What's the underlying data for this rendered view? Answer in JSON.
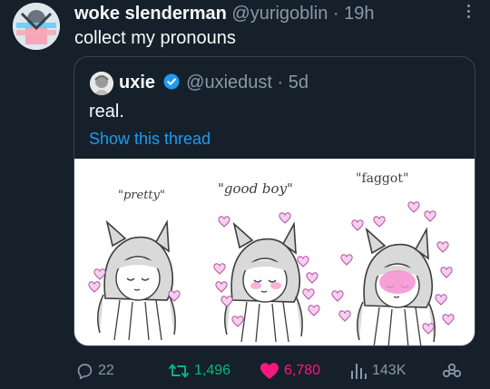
{
  "tweet": {
    "author_name": "woke slenderman",
    "author_handle": "@yurigoblin",
    "separator": "·",
    "time": "19h",
    "text": "collect my pronouns"
  },
  "quoted": {
    "author_name": "uxie",
    "author_handle": "@uxiedust",
    "separator": "·",
    "time": "5d",
    "text": "real.",
    "show_thread": "Show this thread",
    "image": {
      "captions": [
        "\"pretty\"",
        "\"good boy\"",
        "\"faggot\""
      ]
    }
  },
  "actions": {
    "replies": "22",
    "retweets": "1,496",
    "likes": "6,780",
    "views": "143K"
  },
  "icons": {
    "more": "more-options-icon",
    "reply": "reply-icon",
    "retweet": "retweet-icon",
    "like": "heart-icon",
    "views": "views-icon",
    "share": "share-icon",
    "verified": "verified-badge-icon"
  },
  "colors": {
    "background": "#15202b",
    "text": "#f7f9f9",
    "muted": "#8b98a5",
    "link": "#1d9bf0",
    "retweet": "#00ba7c",
    "like": "#f91880"
  }
}
